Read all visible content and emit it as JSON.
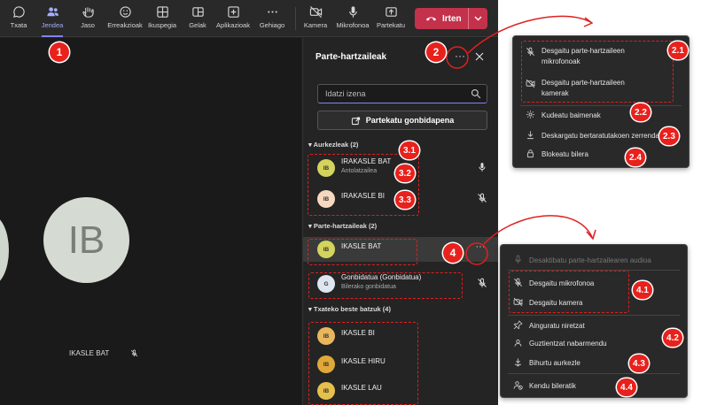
{
  "toolbar": {
    "buttons": [
      {
        "label": "Txata",
        "icon": "chat-icon"
      },
      {
        "label": "Jendea",
        "icon": "people-icon",
        "active": true
      },
      {
        "label": "Jaso",
        "icon": "raise-hand-icon"
      },
      {
        "label": "Erreakzioak",
        "icon": "smiley-icon"
      },
      {
        "label": "Ikuspegia",
        "icon": "view-grid-icon"
      },
      {
        "label": "Gelak",
        "icon": "rooms-icon"
      },
      {
        "label": "Aplikazioak",
        "icon": "apps-plus-icon"
      },
      {
        "label": "Gehiago",
        "icon": "more-icon"
      },
      {
        "label": "Kamera",
        "icon": "camera-off-icon"
      },
      {
        "label": "Mikrofonoa",
        "icon": "microphone-icon"
      },
      {
        "label": "Partekatu",
        "icon": "share-tray-icon"
      }
    ],
    "leave_label": "Irten"
  },
  "stage": {
    "avatar_initials": "IB",
    "name": "IKASLE BAT"
  },
  "panel": {
    "title": "Parte-hartzaileak",
    "search_placeholder": "Idatzi izena",
    "share_label": "Partekatu gonbidapena",
    "sections": {
      "presenters": "Aurkezleak (2)",
      "attendees": "Parte-hartzaileak (2)",
      "others": "Txateko beste batzuk (4)"
    },
    "presenters": [
      {
        "initials": "IB",
        "name": "IRAKASLE BAT",
        "role": "Antolatzailea",
        "mic": "on"
      },
      {
        "initials": "IB",
        "name": "IRAKASLE BI",
        "role": "",
        "mic": "off"
      }
    ],
    "attendees": [
      {
        "initials": "IB",
        "name": "IKASLE BAT",
        "role": ""
      },
      {
        "initials": "G",
        "name": "Gonbidatua (Gonbidatua)",
        "role": "Bilerako gonbidatua",
        "mic": "off"
      }
    ],
    "others": [
      {
        "initials": "IB",
        "name": "IKASLE BI"
      },
      {
        "initials": "IB",
        "name": "IKASLE HIRU"
      },
      {
        "initials": "IB",
        "name": "IKASLE LAU"
      }
    ]
  },
  "menu1": {
    "items": [
      {
        "label_line1": "Desgaitu parte-hartzaileen",
        "label_line2": "mikrofonoak",
        "icon": "mic-off-icon"
      },
      {
        "label_line1": "Desgaitu parte-hartzaileen",
        "label_line2": "kamerak",
        "icon": "camera-off-icon"
      },
      {
        "label_line1": "Kudeatu baimenak",
        "icon": "gear-icon"
      },
      {
        "label_line1": "Deskargatu bertaratutakoen zerrenda",
        "icon": "download-icon"
      },
      {
        "label_line1": "Blokeatu bilera",
        "icon": "lock-icon"
      }
    ]
  },
  "menu2": {
    "items": [
      {
        "label": "Desaktibatu parte-hartzailearen audioa",
        "icon": "mic-icon",
        "disabled": true
      },
      {
        "label": "Desgaitu mikrofonoa",
        "icon": "mic-off-icon"
      },
      {
        "label": "Desgaitu kamera",
        "icon": "camera-off-icon"
      },
      {
        "label": "Ainguratu niretzat",
        "icon": "pin-icon"
      },
      {
        "label": "Guztientzat nabarmendu",
        "icon": "spotlight-icon"
      },
      {
        "label": "Bihurtu aurkezle",
        "icon": "make-presenter-icon"
      },
      {
        "label": "Kendu bileratik",
        "icon": "remove-person-icon"
      }
    ]
  },
  "callouts": [
    "1",
    "2",
    "2.1",
    "2.2",
    "2.3",
    "2.4",
    "3.1",
    "3.2",
    "3.3",
    "4",
    "4.1",
    "4.2",
    "4.3",
    "4.4"
  ],
  "colors": {
    "accent": "#7f85f5",
    "leave": "#c4314b",
    "callout": "#e8211c"
  }
}
